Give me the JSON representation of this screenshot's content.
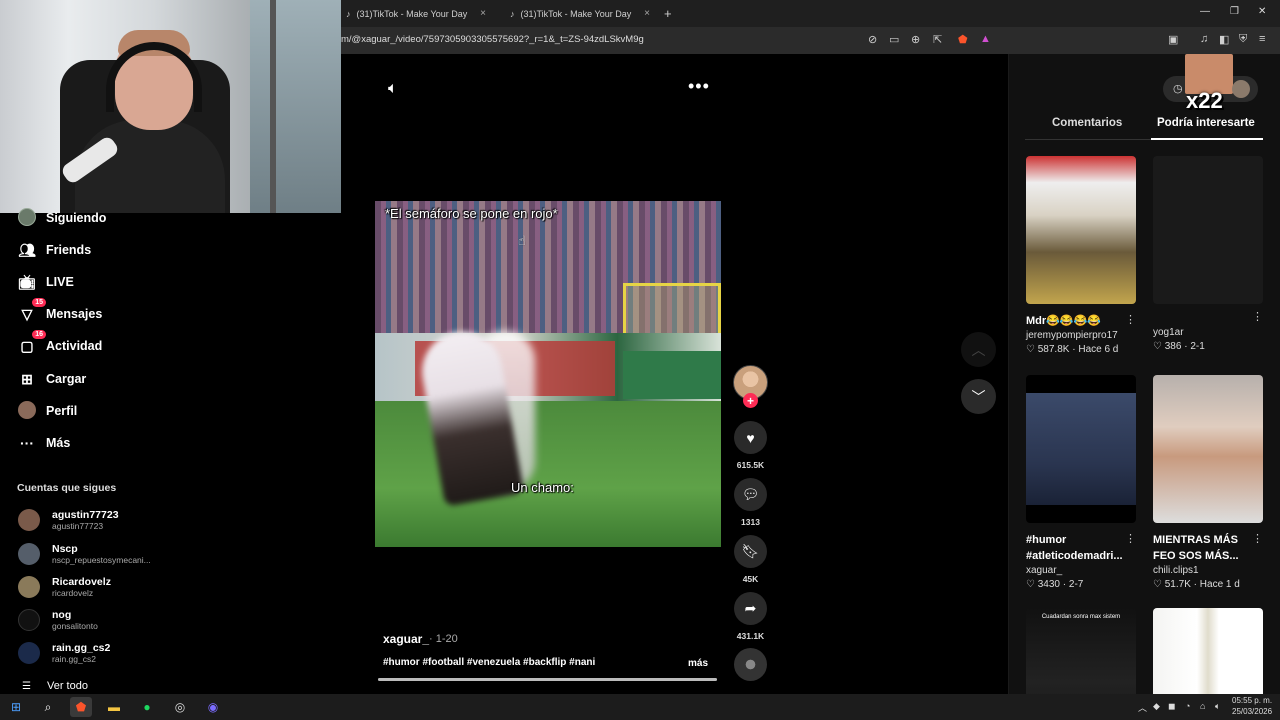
{
  "browser": {
    "tabs": [
      {
        "label": "(31)TikTok - Make Your Day"
      },
      {
        "label": "(31)TikTok - Make Your Day"
      }
    ],
    "new_tab_icon": "plus-icon",
    "url": "m/@xaguar_/video/7597305903305575692?_r=1&_t=ZS-94zdLSkvM9g"
  },
  "sidebar": {
    "items": [
      {
        "label": "Siguiendo",
        "icon": "following-avatar-icon"
      },
      {
        "label": "Friends",
        "icon": "friends-icon"
      },
      {
        "label": "LIVE",
        "icon": "live-icon"
      },
      {
        "label": "Mensajes",
        "icon": "messages-icon",
        "badge": "15"
      },
      {
        "label": "Actividad",
        "icon": "activity-icon",
        "badge": "16"
      },
      {
        "label": "Cargar",
        "icon": "upload-icon"
      },
      {
        "label": "Perfil",
        "icon": "profile-avatar-icon"
      },
      {
        "label": "Más",
        "icon": "more-icon"
      }
    ],
    "following_title": "Cuentas que sigues",
    "accounts": [
      {
        "name": "agustin77723",
        "handle": "agustin77723"
      },
      {
        "name": "Nscp",
        "handle": "nscp_repuestosymecani..."
      },
      {
        "name": "Ricardovelz",
        "handle": "ricardovelz"
      },
      {
        "name": "nog",
        "handle": "gonsalitonto"
      },
      {
        "name": "rain.gg_cs2",
        "handle": "rain.gg_cs2"
      }
    ],
    "see_all": "Ver todo"
  },
  "video": {
    "caption_top": "*El semáforo se pone en rojo*",
    "caption_bottom": "Un chamo:",
    "author": "xaguar_",
    "date": "· 1-20",
    "description": "#humor #football #venezuela #backflip #nani",
    "more_label": "más",
    "progress": 1.0,
    "actions": {
      "likes": "615.5K",
      "comments": "1313",
      "saves": "45K",
      "shares": "431.1K"
    }
  },
  "right_panel": {
    "overlay_text": "x22",
    "tabs": [
      "Comentarios",
      "Podría interesarte"
    ],
    "active_tab": "Podría interesarte",
    "cards": [
      {
        "title": "Mdr😂😂😂😂",
        "user": "jeremypompierpro17",
        "likes": "587.8K",
        "date": "Hace 6 d"
      },
      {
        "title": "",
        "user": "yog1ar",
        "likes": "386",
        "date": "2-1"
      },
      {
        "title": "#humor #atleticodemadri...",
        "user": "xaguar_",
        "likes": "3430",
        "date": "2-7"
      },
      {
        "title": "MIENTRAS MÁS FEO SOS MÁS...",
        "user": "chili.clips1",
        "likes": "51.7K",
        "date": "Hace 1 d"
      },
      {
        "title": "",
        "user": "",
        "likes": "",
        "date": "",
        "thumb_caption": "Cuadardan sonra max sistem"
      },
      {
        "title": "",
        "user": "",
        "likes": "",
        "date": ""
      }
    ]
  },
  "taskbar": {
    "time": "05:55 p. m.",
    "date": "25/03/2026"
  },
  "colors": {
    "accent": "#fe2c55",
    "background": "#000000",
    "panel": "#111111"
  }
}
